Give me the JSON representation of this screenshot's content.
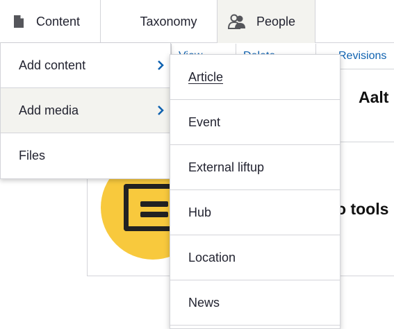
{
  "toolbar": {
    "items": [
      {
        "label": "Content",
        "icon": "document-icon"
      },
      {
        "label": "Taxonomy",
        "icon": null
      },
      {
        "label": "People",
        "icon": "people-icon"
      }
    ]
  },
  "content_menu": {
    "items": [
      {
        "label": "Add content",
        "has_submenu": true
      },
      {
        "label": "Add media",
        "has_submenu": true
      },
      {
        "label": "Files",
        "has_submenu": false
      }
    ]
  },
  "add_content_submenu": {
    "items": [
      {
        "label": "Article"
      },
      {
        "label": "Event"
      },
      {
        "label": "External liftup"
      },
      {
        "label": "Hub"
      },
      {
        "label": "Location"
      },
      {
        "label": "News"
      }
    ]
  },
  "background": {
    "tabs": [
      "View",
      "Delete",
      "Revisions"
    ],
    "title_fragment": "Aalt",
    "card_text_fragment": "o tools"
  },
  "colors": {
    "accent": "#0f62b0",
    "active_bg": "#f3f3ef",
    "card_circle": "#f8c93d",
    "border": "#d3d4d9",
    "text": "#222330"
  }
}
